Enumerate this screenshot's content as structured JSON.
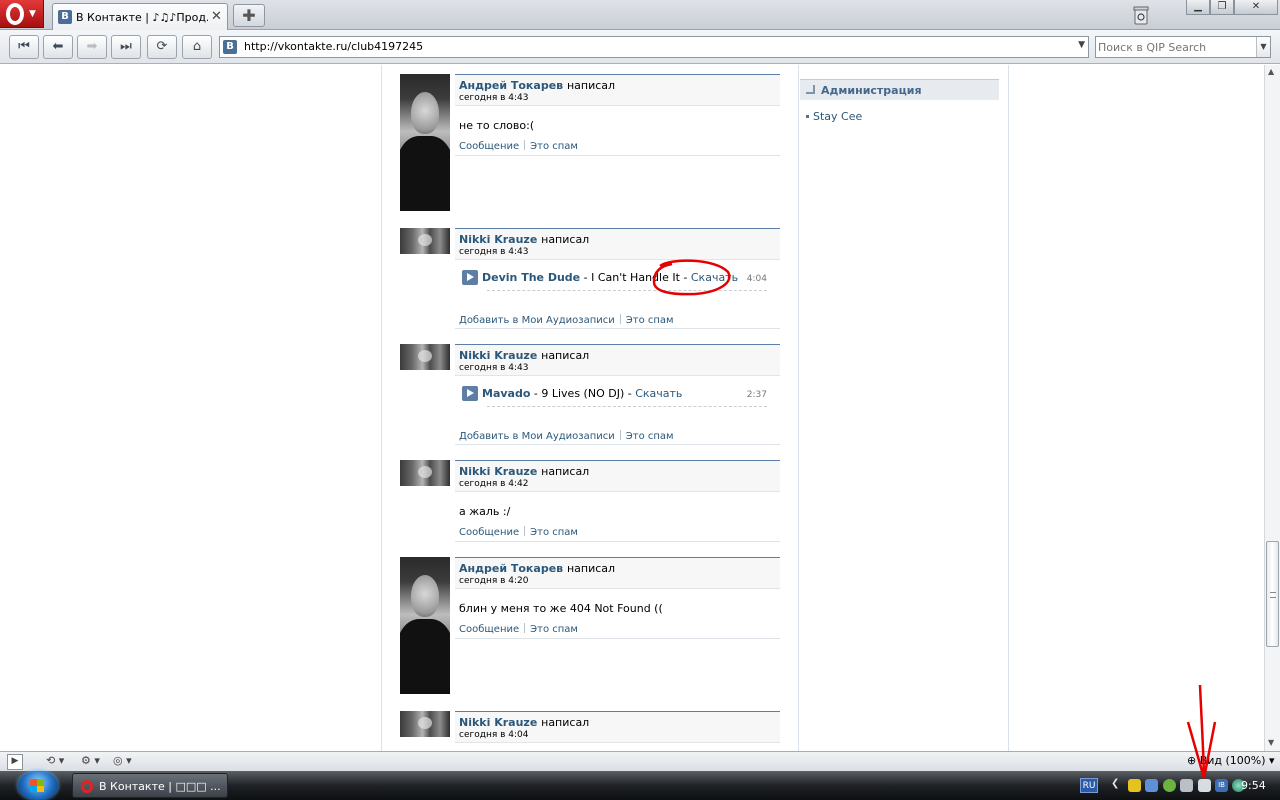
{
  "browser": {
    "tab_title": "В Контакте | ♪♫♪Прод...",
    "tab_favicon": "В",
    "url": "http://vkontakte.ru/club4197245",
    "search_placeholder": "Поиск в QIP Search",
    "zoom": "Вид (100%)"
  },
  "posts": [
    {
      "author": "Андрей Токарев",
      "wrote": "написал",
      "date": "сегодня в 4:43",
      "text": "не то слово:(",
      "action_main": "Сообщение",
      "action_spam": "Это спам"
    },
    {
      "author": "Nikki Krauze",
      "wrote": "написал",
      "date": "сегодня в 4:43",
      "audio_artist": "Devin The Dude",
      "audio_title": " - I Can't Handle It - ",
      "audio_download": "Скачать",
      "audio_duration": "4:04",
      "action_main": "Добавить в Мои Аудиозаписи",
      "action_spam": "Это спам"
    },
    {
      "author": "Nikki Krauze",
      "wrote": "написал",
      "date": "сегодня в 4:43",
      "audio_artist": "Mavado",
      "audio_title": " - 9 Lives (NO DJ) - ",
      "audio_download": "Скачать",
      "audio_duration": "2:37",
      "action_main": "Добавить в Мои Аудиозаписи",
      "action_spam": "Это спам"
    },
    {
      "author": "Nikki Krauze",
      "wrote": "написал",
      "date": "сегодня в 4:42",
      "text": "а жаль :/",
      "action_main": "Сообщение",
      "action_spam": "Это спам"
    },
    {
      "author": "Андрей Токарев",
      "wrote": "написал",
      "date": "сегодня в 4:20",
      "text": "блин у меня то же 404 Not Found ((",
      "action_main": "Сообщение",
      "action_spam": "Это спам"
    },
    {
      "author": "Nikki Krauze",
      "wrote": "написал",
      "date": "сегодня в 4:04"
    }
  ],
  "sidebar": {
    "admin_title": "Администрация",
    "admin_member": "Stay Cee"
  },
  "taskbar": {
    "item_label": "В Контакте | □□□ ...",
    "lang": "RU",
    "clock": "9:54"
  },
  "colors": {
    "vk_link": "#2b587a",
    "annotation": "#e60000"
  }
}
